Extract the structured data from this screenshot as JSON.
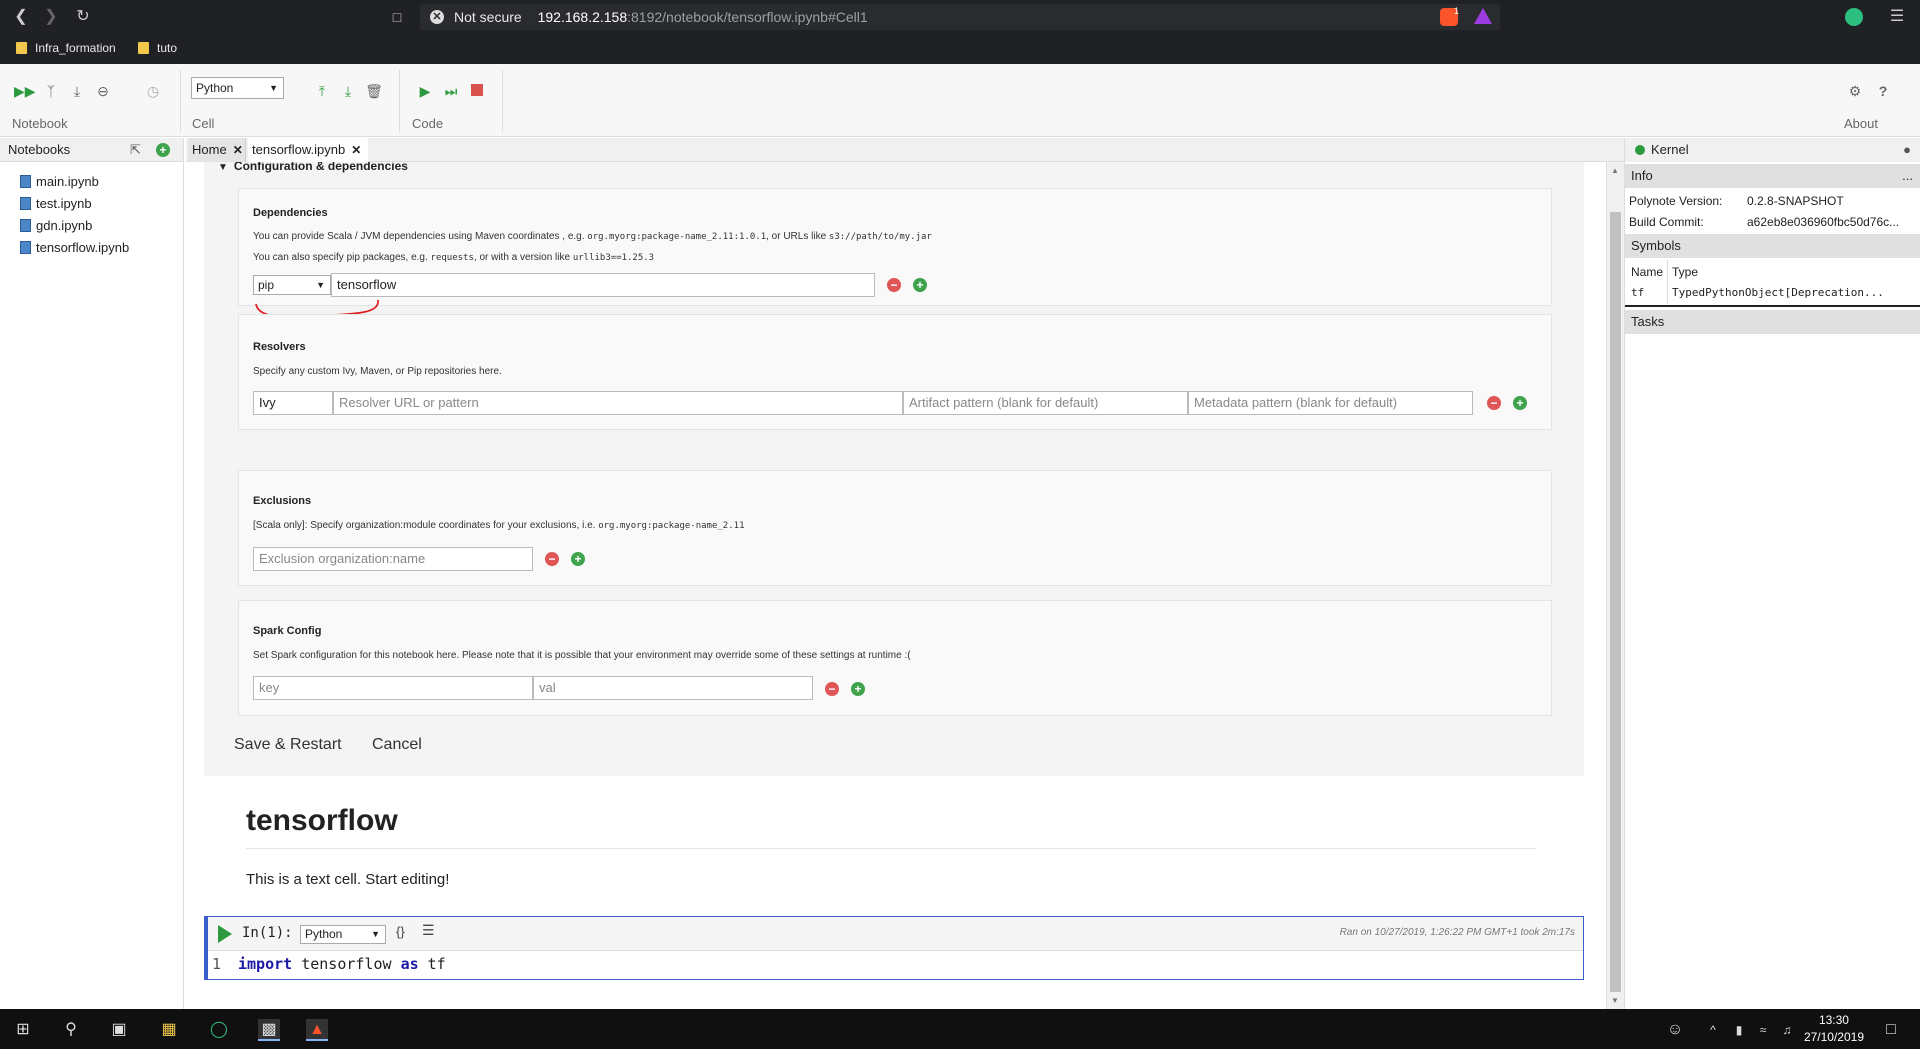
{
  "browser": {
    "security_label": "Not secure",
    "url_host": "192.168.2.158",
    "url_path": ":8192/notebook/tensorflow.ipynb#Cell1",
    "brave_badge": "1",
    "bookmarks": [
      "Infra_formation",
      "tuto"
    ]
  },
  "toolbar": {
    "cell_language": "Python",
    "group_labels": {
      "notebook": "Notebook",
      "cell": "Cell",
      "code": "Code",
      "about": "About"
    }
  },
  "left_panel": {
    "title": "Notebooks",
    "notebooks": [
      "main.ipynb",
      "test.ipynb",
      "gdn.ipynb",
      "tensorflow.ipynb"
    ]
  },
  "tabs": [
    {
      "label": "Home"
    },
    {
      "label": "tensorflow.ipynb"
    }
  ],
  "config": {
    "header": "Configuration & dependencies",
    "dependencies": {
      "title": "Dependencies",
      "desc1_a": "You can provide Scala / JVM dependencies using Maven coordinates , e.g. ",
      "desc1_code1": "org.myorg:package-name_2.11:1.0.1",
      "desc1_b": ", or URLs like ",
      "desc1_code2": "s3://path/to/my.jar",
      "desc2_a": "You can also specify pip packages, e.g. ",
      "desc2_code1": "requests",
      "desc2_b": ", or with a version like ",
      "desc2_code2": "urllib3==1.25.3",
      "type_value": "pip",
      "dep_value": "tensorflow"
    },
    "resolvers": {
      "title": "Resolvers",
      "desc": "Specify any custom Ivy, Maven, or Pip repositories here.",
      "type_value": "Ivy",
      "url_placeholder": "Resolver URL or pattern",
      "artifact_placeholder": "Artifact pattern (blank for default)",
      "metadata_placeholder": "Metadata pattern (blank for default)"
    },
    "exclusions": {
      "title": "Exclusions",
      "desc_a": "[Scala only]: Specify organization:module coordinates for your exclusions, i.e. ",
      "desc_code": "org.myorg:package-name_2.11",
      "placeholder": "Exclusion organization:name"
    },
    "spark": {
      "title": "Spark Config",
      "desc": "Set Spark configuration for this notebook here. Please note that it is possible that your environment may override some of these settings at runtime :(",
      "key_placeholder": "key",
      "val_placeholder": "val"
    },
    "save_label": "Save & Restart",
    "cancel_label": "Cancel"
  },
  "text_cell": {
    "heading": "tensorflow",
    "body": "This is a text cell. Start editing!"
  },
  "code_cell": {
    "prompt": "In(1):",
    "language": "Python",
    "run_info": "Ran on 10/27/2019, 1:26:22 PM GMT+1 took 2m:17s",
    "line_number": "1",
    "code_kw1": "import",
    "code_mid": " tensorflow ",
    "code_kw2": "as",
    "code_end": " tf"
  },
  "right_panel": {
    "kernel_label": "Kernel",
    "info_label": "Info",
    "info_more": "...",
    "polynote_version_key": "Polynote Version:",
    "polynote_version_val": "0.2.8-SNAPSHOT",
    "build_commit_key": "Build Commit:",
    "build_commit_val": "a62eb8e036960fbc50d76c...",
    "symbols_label": "Symbols",
    "col_name": "Name",
    "col_type": "Type",
    "symbol_name": "tf",
    "symbol_type": "TypedPythonObject[Deprecation...",
    "tasks_label": "Tasks"
  },
  "taskbar": {
    "time": "13:30",
    "date": "27/10/2019"
  },
  "colors": {
    "accent": "#3b5eca",
    "run_green": "#2e9a3e",
    "stop_red": "#d9534f",
    "annotation_red": "#e02020"
  }
}
